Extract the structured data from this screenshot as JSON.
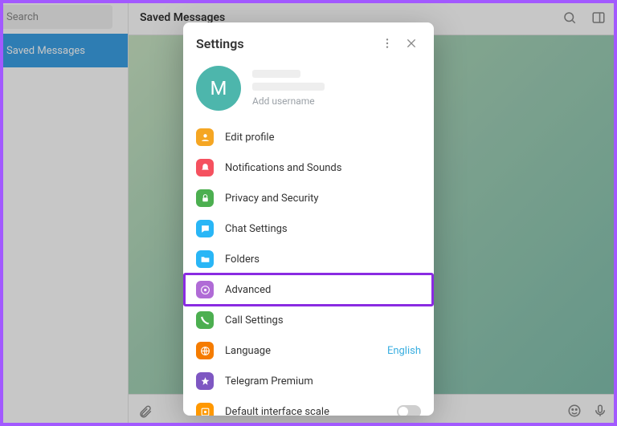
{
  "sidebar": {
    "search_placeholder": "Search",
    "chats": [
      {
        "label": "Saved Messages"
      }
    ]
  },
  "chat": {
    "title": "Saved Messages"
  },
  "settings": {
    "title": "Settings",
    "profile": {
      "avatar_letter": "M",
      "add_username": "Add username"
    },
    "items": [
      {
        "icon": "edit-profile-icon",
        "icon_color": "#f5a623",
        "label": "Edit profile"
      },
      {
        "icon": "notifications-icon",
        "icon_color": "#f5515f",
        "label": "Notifications and Sounds"
      },
      {
        "icon": "privacy-icon",
        "icon_color": "#4caf50",
        "label": "Privacy and Security"
      },
      {
        "icon": "chat-settings-icon",
        "icon_color": "#29b6f6",
        "label": "Chat Settings"
      },
      {
        "icon": "folders-icon",
        "icon_color": "#29b6f6",
        "label": "Folders"
      },
      {
        "icon": "advanced-icon",
        "icon_color": "#b06bd6",
        "label": "Advanced",
        "highlighted": true
      },
      {
        "icon": "call-settings-icon",
        "icon_color": "#4caf50",
        "label": "Call Settings"
      },
      {
        "icon": "language-icon",
        "icon_color": "#f57c00",
        "label": "Language",
        "value": "English"
      }
    ],
    "premium": {
      "icon_color": "#7e57c2",
      "label": "Telegram Premium"
    },
    "scale": {
      "icon_color": "#ff9800",
      "label": "Default interface scale",
      "enabled": false
    }
  }
}
